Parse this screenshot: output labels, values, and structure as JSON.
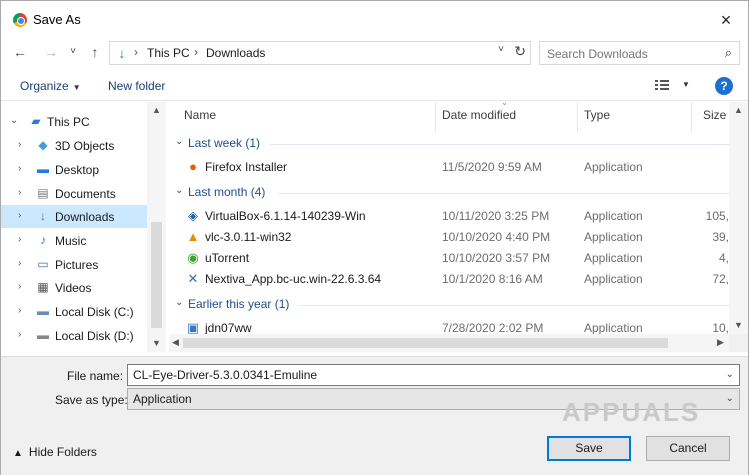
{
  "window": {
    "title": "Save As",
    "close_icon": "×"
  },
  "nav": {
    "back_icon": "←",
    "forward_icon": "→",
    "recent_icon": "˅",
    "up_icon": "↑",
    "address_icon": "↓",
    "breadcrumbs": [
      "This PC",
      "Downloads"
    ],
    "breadcrumb_sep": "›",
    "address_dropdown_icon": "˅",
    "refresh_icon": "↻",
    "search_placeholder": "Search Downloads",
    "search_icon": "⌕"
  },
  "toolbar": {
    "organize_label": "Organize",
    "new_folder_label": "New folder",
    "help_icon": "?"
  },
  "tree": [
    {
      "label": "This PC",
      "icon": "pc-icon",
      "expanded": true
    },
    {
      "label": "3D Objects",
      "icon": "cube-icon"
    },
    {
      "label": "Desktop",
      "icon": "desktop-icon"
    },
    {
      "label": "Documents",
      "icon": "documents-icon"
    },
    {
      "label": "Downloads",
      "icon": "download-icon",
      "selected": true
    },
    {
      "label": "Music",
      "icon": "music-icon"
    },
    {
      "label": "Pictures",
      "icon": "pictures-icon"
    },
    {
      "label": "Videos",
      "icon": "videos-icon"
    },
    {
      "label": "Local Disk (C:)",
      "icon": "disk-c-icon"
    },
    {
      "label": "Local Disk (D:)",
      "icon": "disk-d-icon"
    }
  ],
  "columns": {
    "name": "Name",
    "date": "Date modified",
    "type": "Type",
    "size": "Size"
  },
  "groups": [
    {
      "label": "Last week (1)",
      "files": [
        {
          "name": "Firefox Installer",
          "date": "11/5/2020 9:59 AM",
          "type": "Application",
          "size": "",
          "icon": "firefox-icon"
        }
      ]
    },
    {
      "label": "Last month (4)",
      "files": [
        {
          "name": "VirtualBox-6.1.14-140239-Win",
          "date": "10/11/2020 3:25 PM",
          "type": "Application",
          "size": "105,",
          "icon": "virtualbox-icon"
        },
        {
          "name": "vlc-3.0.11-win32",
          "date": "10/10/2020 4:40 PM",
          "type": "Application",
          "size": "39,",
          "icon": "vlc-icon"
        },
        {
          "name": "uTorrent",
          "date": "10/10/2020 3:57 PM",
          "type": "Application",
          "size": "4,",
          "icon": "utorrent-icon"
        },
        {
          "name": "Nextiva_App.bc-uc.win-22.6.3.64",
          "date": "10/1/2020 8:16 AM",
          "type": "Application",
          "size": "72,",
          "icon": "nextiva-icon"
        }
      ]
    },
    {
      "label": "Earlier this year (1)",
      "files": [
        {
          "name": "jdn07ww",
          "date": "7/28/2020 2:02 PM",
          "type": "Application",
          "size": "10,",
          "icon": "app-window-icon"
        }
      ]
    }
  ],
  "form": {
    "file_name_label": "File name:",
    "file_name_value": "CL-Eye-Driver-5.3.0.0341-Emuline",
    "save_type_label": "Save as type:",
    "save_type_value": "Application",
    "hide_folders_label": "Hide Folders",
    "save_label": "Save",
    "cancel_label": "Cancel"
  },
  "watermark": "APPUALS",
  "colors": {
    "accent": "#0078d7",
    "selected_bg": "#cce8ff",
    "group_text": "#1e4e8c",
    "help": "#1d6fd1"
  }
}
